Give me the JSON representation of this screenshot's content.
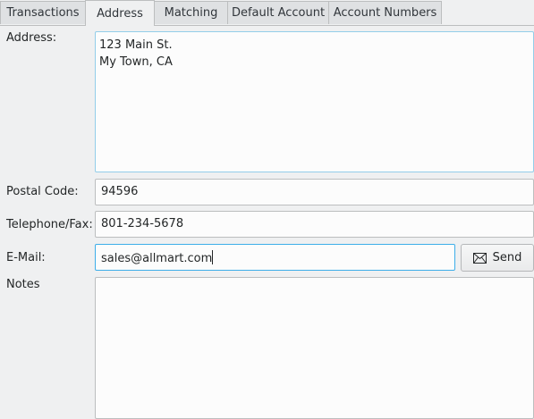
{
  "tabs": [
    {
      "label": "Transactions",
      "active": false
    },
    {
      "label": "Address",
      "active": true
    },
    {
      "label": "Matching",
      "active": false
    },
    {
      "label": "Default Account",
      "active": false
    },
    {
      "label": "Account Numbers",
      "active": false
    }
  ],
  "form": {
    "address_label": "Address:",
    "address_lines": [
      "123 Main St.",
      "My Town, CA"
    ],
    "postal_label": "Postal Code:",
    "postal_value": "94596",
    "phone_label": "Telephone/Fax:",
    "phone_value": "801-234-5678",
    "email_label": "E-Mail:",
    "email_value": "sales@allmart.com",
    "send_label": "Send",
    "send_icon": "envelope-icon",
    "notes_label": "Notes",
    "notes_value": ""
  },
  "colors": {
    "accent": "#3daee9"
  }
}
